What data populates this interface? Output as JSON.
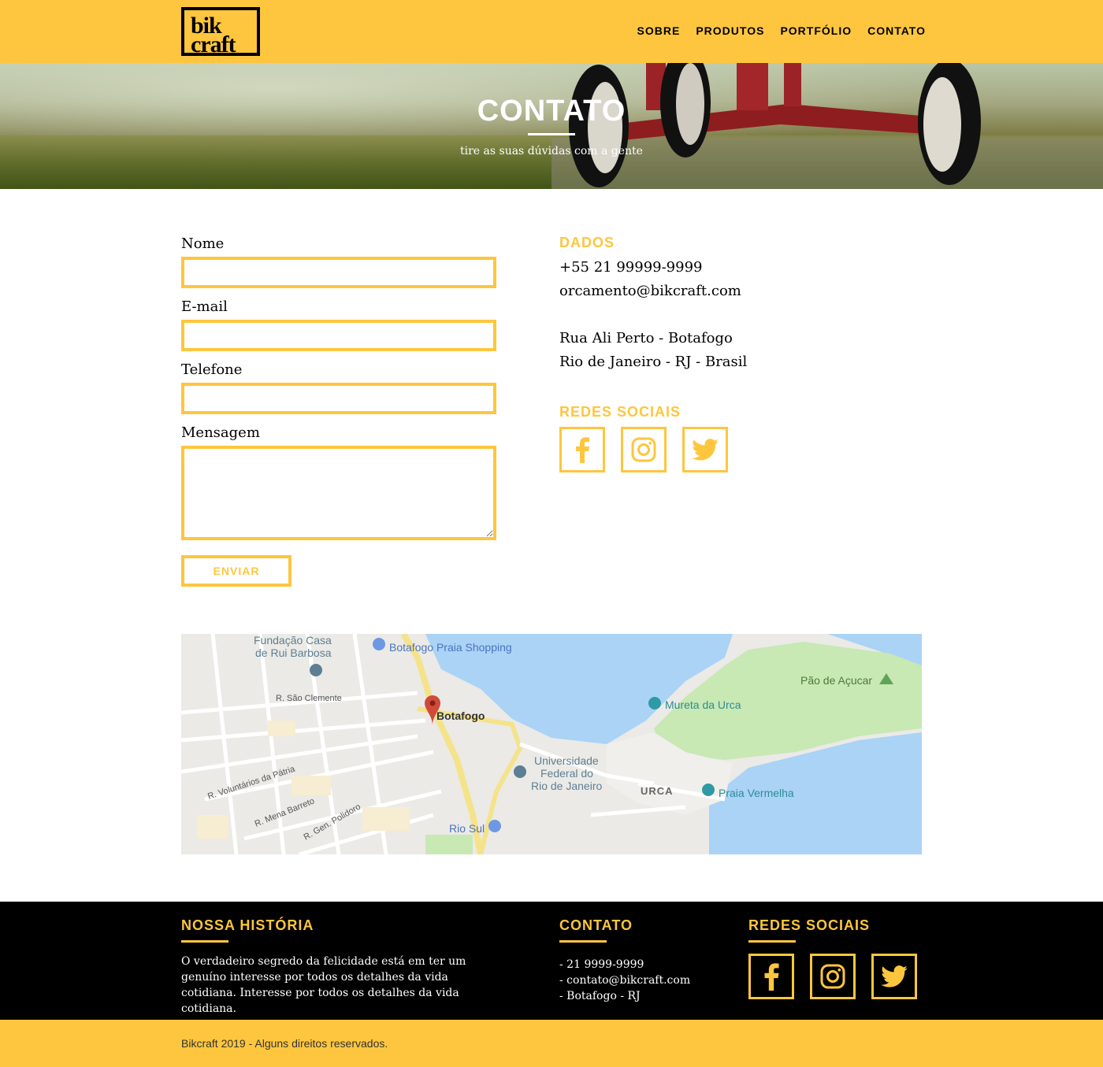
{
  "header": {
    "logo_line1": "bik",
    "logo_line2": "craft",
    "nav": [
      "SOBRE",
      "PRODUTOS",
      "PORTFÓLIO",
      "CONTATO"
    ]
  },
  "hero": {
    "title": "CONTATO",
    "subtitle": "tire as suas dúvidas com a gente"
  },
  "form": {
    "name_label": "Nome",
    "email_label": "E-mail",
    "phone_label": "Telefone",
    "message_label": "Mensagem",
    "submit_label": "ENVIAR"
  },
  "info": {
    "data_title": "DADOS",
    "phone": "+55 21 99999-9999",
    "email": "orcamento@bikcraft.com",
    "address_line1": "Rua Ali Perto - Botafogo",
    "address_line2": "Rio de Janeiro - RJ - Brasil",
    "social_title": "REDES SOCIAIS",
    "social_icons": [
      "facebook-icon",
      "instagram-icon",
      "twitter-icon"
    ]
  },
  "map": {
    "labels": {
      "fundacao_1": "Fundação Casa",
      "fundacao_2": "de Rui Barbosa",
      "shopping": "Botafogo Praia Shopping",
      "sao_clemente": "R. São Clemente",
      "botafogo": "Botafogo",
      "pao_acucar": "Pão de Açucar",
      "mureta": "Mureta da Urca",
      "uni_1": "Universidade",
      "uni_2": "Federal do",
      "uni_3": "Rio de Janeiro",
      "urca": "URCA",
      "praia_vermelha": "Praia Vermelha",
      "voluntarios": "R. Voluntários da Pátria",
      "mena_barreto": "R. Mena Barreto",
      "gen_polidoro": "R. Gen. Polidoro",
      "rio_sul": "Rio Sul"
    }
  },
  "footer": {
    "history_title": "NOSSA HISTÓRIA",
    "history_text": "O verdadeiro segredo da felicidade está em ter um genuíno interesse por todos os detalhes da vida cotidiana. Interesse por todos os detalhes da vida cotidiana.",
    "contact_title": "CONTATO",
    "contact_items": [
      "- 21 9999-9999",
      "- contato@bikcraft.com",
      "- Botafogo - RJ"
    ],
    "social_title": "REDES SOCIAIS",
    "copyright": "Bikcraft 2019 - Alguns direitos reservados."
  },
  "colors": {
    "accent": "#FEC63E",
    "dark": "#000000",
    "map_water": "#aad3f6",
    "map_park": "#c8e8b4"
  }
}
